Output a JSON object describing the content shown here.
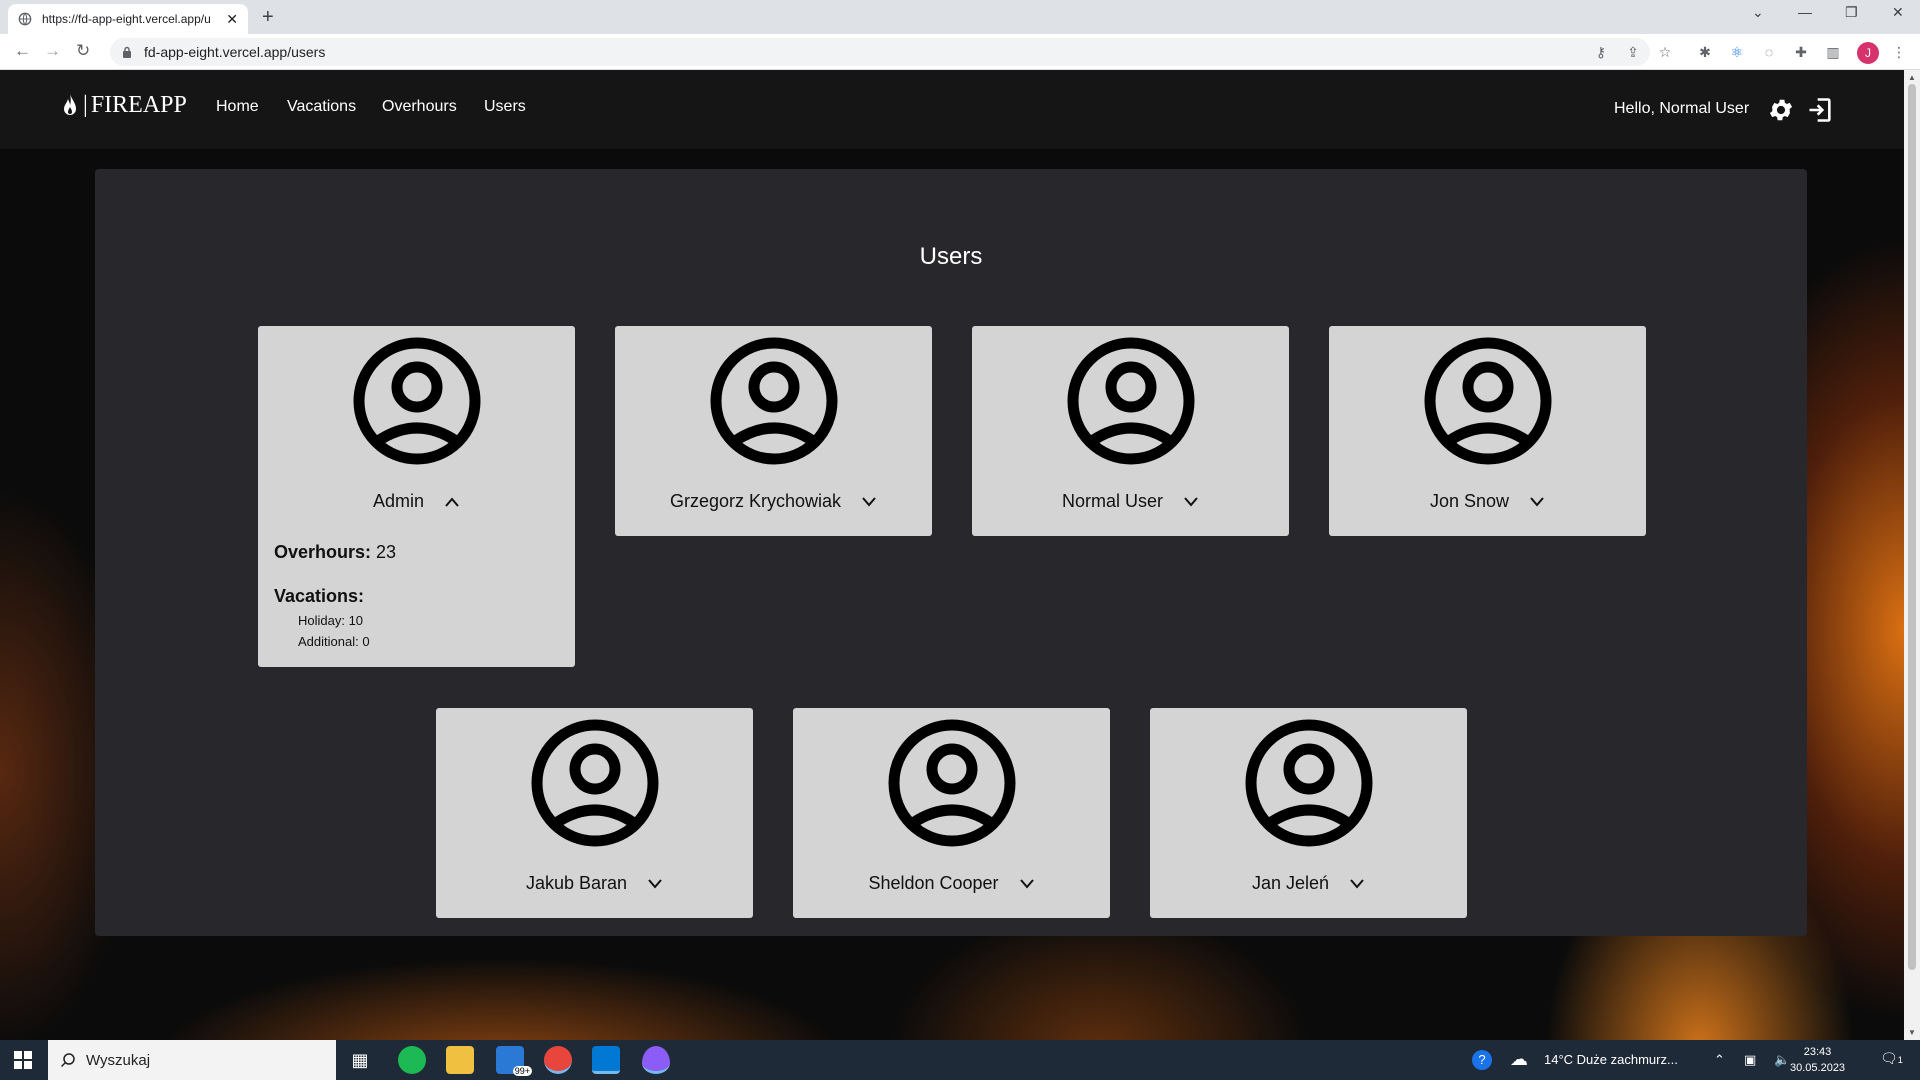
{
  "browser": {
    "tab_title": "https://fd-app-eight.vercel.app/u",
    "url": "fd-app-eight.vercel.app/users",
    "profile_initial": "J"
  },
  "app": {
    "brand": "FIREAPP",
    "brand_sep": "|",
    "nav": [
      "Home",
      "Vacations",
      "Overhours",
      "Users"
    ],
    "greeting": "Hello, Normal User",
    "page_title": "Users"
  },
  "users": [
    {
      "name": "Admin",
      "expanded": true
    },
    {
      "name": "Grzegorz Krychowiak",
      "expanded": false
    },
    {
      "name": "Normal User",
      "expanded": false
    },
    {
      "name": "Jon Snow",
      "expanded": false
    },
    {
      "name": "Jakub Baran",
      "expanded": false
    },
    {
      "name": "Sheldon Cooper",
      "expanded": false
    },
    {
      "name": "Jan Jeleń",
      "expanded": false
    }
  ],
  "admin_details": {
    "overhours_label": "Overhours:",
    "overhours_value": "23",
    "vacations_label": "Vacations:",
    "holiday": "Holiday: 10",
    "additional": "Additional: 0"
  },
  "taskbar": {
    "search_placeholder": "Wyszukaj",
    "mail_badge": "99+",
    "weather": "14°C  Duże zachmurz...",
    "time": "23:43",
    "date": "30.05.2023",
    "notif_count": "1"
  },
  "colors": {
    "navbar_bg": "#151515",
    "panel_bg": "#28282c",
    "card_bg": "#d4d4d4"
  }
}
